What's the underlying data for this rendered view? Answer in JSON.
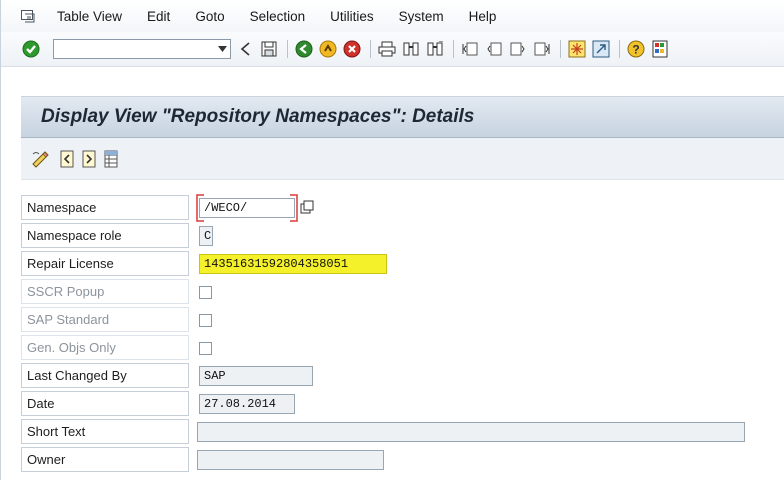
{
  "menu": {
    "items": [
      {
        "label": "Table View",
        "name": "menu-table-view"
      },
      {
        "label": "Edit",
        "name": "menu-edit"
      },
      {
        "label": "Goto",
        "name": "menu-goto"
      },
      {
        "label": "Selection",
        "name": "menu-selection"
      },
      {
        "label": "Utilities",
        "name": "menu-utilities"
      },
      {
        "label": "System",
        "name": "menu-system"
      },
      {
        "label": "Help",
        "name": "menu-help"
      }
    ]
  },
  "toolbar": {
    "command_field_value": ""
  },
  "title": "Display View \"Repository Namespaces\": Details",
  "form": {
    "namespace": {
      "label": "Namespace",
      "value": "/WECO/"
    },
    "namespace_role": {
      "label": "Namespace role",
      "value": "C"
    },
    "repair_license": {
      "label": "Repair License",
      "value": "14351631592804358051"
    },
    "sscr_popup": {
      "label": "SSCR Popup",
      "checked": false
    },
    "sap_standard": {
      "label": "SAP Standard",
      "checked": false
    },
    "gen_objs_only": {
      "label": "Gen. Objs Only",
      "checked": false
    },
    "last_changed_by": {
      "label": "Last Changed By",
      "value": "SAP"
    },
    "date": {
      "label": "Date",
      "value": "27.08.2014"
    },
    "short_text": {
      "label": "Short Text",
      "value": ""
    },
    "owner": {
      "label": "Owner",
      "value": ""
    }
  },
  "colors": {
    "highlight": "#f4f02a",
    "title_bg": "#c7d3e0",
    "accent_green": "#2e9a2e"
  }
}
